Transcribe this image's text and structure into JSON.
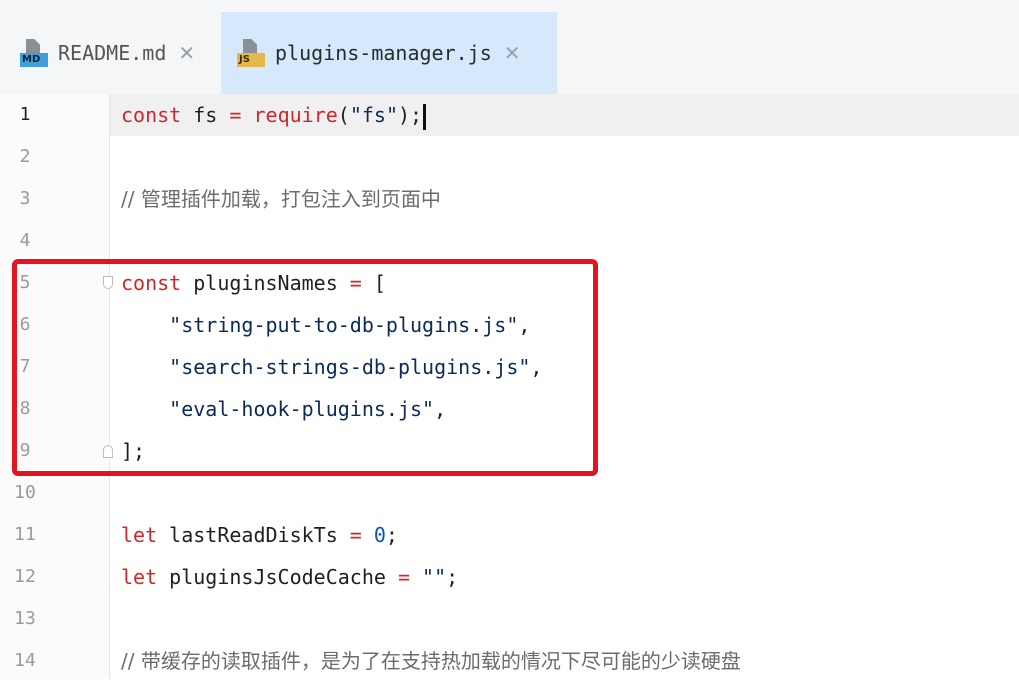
{
  "tabs": [
    {
      "label": "README.md",
      "icon": "md-file-icon",
      "badge": "MD",
      "active": false
    },
    {
      "label": "plugins-manager.js",
      "icon": "js-file-icon",
      "badge": "JS",
      "active": true
    }
  ],
  "tab_close_symbol": "✕",
  "lines": [
    {
      "num": "1",
      "tokens": [
        [
          "kw",
          "const"
        ],
        [
          "txt",
          " fs "
        ],
        [
          "op",
          "="
        ],
        [
          "txt",
          " "
        ],
        [
          "kw",
          "require"
        ],
        [
          "txt",
          "("
        ],
        [
          "str",
          "\"fs\""
        ],
        [
          "txt",
          ");"
        ]
      ]
    },
    {
      "num": "2",
      "tokens": []
    },
    {
      "num": "3",
      "tokens": [
        [
          "cmt",
          "// 管理插件加载，打包注入到页面中"
        ]
      ]
    },
    {
      "num": "4",
      "tokens": []
    },
    {
      "num": "5",
      "tokens": [
        [
          "kw",
          "const"
        ],
        [
          "txt",
          " pluginsNames "
        ],
        [
          "op",
          "="
        ],
        [
          "txt",
          " ["
        ]
      ]
    },
    {
      "num": "6",
      "tokens": [
        [
          "txt",
          "    "
        ],
        [
          "str",
          "\"string-put-to-db-plugins.js\""
        ],
        [
          "txt",
          ","
        ]
      ]
    },
    {
      "num": "7",
      "tokens": [
        [
          "txt",
          "    "
        ],
        [
          "str",
          "\"search-strings-db-plugins.js\""
        ],
        [
          "txt",
          ","
        ]
      ]
    },
    {
      "num": "8",
      "tokens": [
        [
          "txt",
          "    "
        ],
        [
          "str",
          "\"eval-hook-plugins.js\""
        ],
        [
          "txt",
          ","
        ]
      ]
    },
    {
      "num": "9",
      "tokens": [
        [
          "txt",
          "];"
        ]
      ]
    },
    {
      "num": "10",
      "tokens": []
    },
    {
      "num": "11",
      "tokens": [
        [
          "kw",
          "let"
        ],
        [
          "txt",
          " lastReadDiskTs "
        ],
        [
          "op",
          "="
        ],
        [
          "txt",
          " "
        ],
        [
          "num",
          "0"
        ],
        [
          "txt",
          ";"
        ]
      ]
    },
    {
      "num": "12",
      "tokens": [
        [
          "kw",
          "let"
        ],
        [
          "txt",
          " pluginsJsCodeCache "
        ],
        [
          "op",
          "="
        ],
        [
          "txt",
          " "
        ],
        [
          "str",
          "\"\""
        ],
        [
          "txt",
          ";"
        ]
      ]
    },
    {
      "num": "13",
      "tokens": []
    },
    {
      "num": "14",
      "tokens": [
        [
          "cmt",
          "// 带缓存的读取插件，是为了在支持热加载的情况下尽可能的少读硬盘"
        ]
      ]
    }
  ],
  "active_line": "1",
  "colors": {
    "keyword": "#d1262b",
    "string": "#0b2a59",
    "number": "#0b57b5",
    "comment": "#6c6c6c",
    "highlight": "#e0151f",
    "active_tab": "#d6e8fb"
  }
}
